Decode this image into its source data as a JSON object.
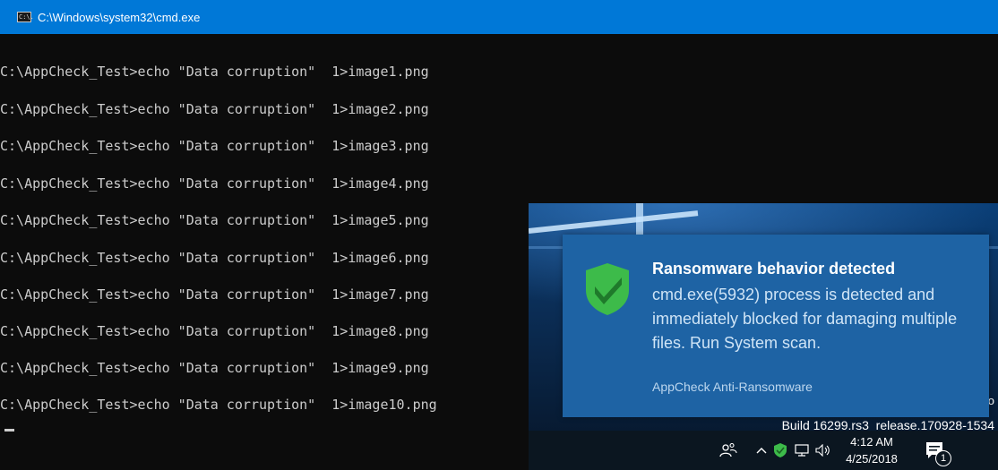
{
  "window": {
    "title": "C:\\Windows\\system32\\cmd.exe",
    "icon": "cmd-icon",
    "icon_text": "C:\\."
  },
  "console": {
    "lines": [
      "C:\\AppCheck_Test>echo \"Data corruption\"  1>image1.png",
      "C:\\AppCheck_Test>echo \"Data corruption\"  1>image2.png",
      "C:\\AppCheck_Test>echo \"Data corruption\"  1>image3.png",
      "C:\\AppCheck_Test>echo \"Data corruption\"  1>image4.png",
      "C:\\AppCheck_Test>echo \"Data corruption\"  1>image5.png",
      "C:\\AppCheck_Test>echo \"Data corruption\"  1>image6.png",
      "C:\\AppCheck_Test>echo \"Data corruption\"  1>image7.png",
      "C:\\AppCheck_Test>echo \"Data corruption\"  1>image8.png",
      "C:\\AppCheck_Test>echo \"Data corruption\"  1>image9.png",
      "C:\\AppCheck_Test>echo \"Data corruption\"  1>image10.png"
    ]
  },
  "desktop": {
    "edition_fragment": "ro",
    "build": "Build 16299.rs3_release.170928-1534"
  },
  "toast": {
    "icon": "shield-check-icon",
    "title": "Ransomware behavior detected",
    "body": "cmd.exe(5932) process is detected and immediately blocked for damaging multiple files. Run System scan.",
    "source": "AppCheck Anti-Ransomware"
  },
  "taskbar": {
    "time": "4:12 AM",
    "date": "4/25/2018",
    "notification_count": "1",
    "icons": [
      "people-icon",
      "chevron-up-icon",
      "appcheck-tray-icon",
      "network-icon",
      "volume-icon",
      "action-center-icon"
    ]
  },
  "colors": {
    "titlebar": "#0078d7",
    "console_bg": "#0c0c0c",
    "console_text": "#cccccc",
    "toast_bg": "#1e63a4",
    "shield_green": "#3dbb4a"
  }
}
